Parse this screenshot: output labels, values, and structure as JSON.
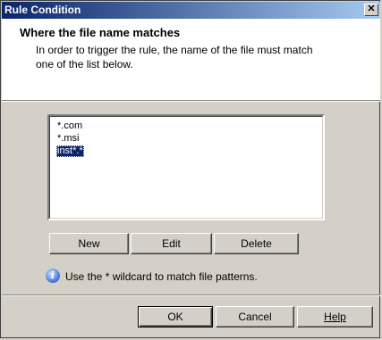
{
  "window": {
    "title": "Rule Condition",
    "close_glyph": "✕"
  },
  "header": {
    "title": "Where the file name matches",
    "description": "In order to trigger the rule, the name of the file must match one of the list below."
  },
  "patterns": {
    "items": [
      "*.com",
      "*.msi",
      "inst*.*"
    ],
    "selected_index": 2
  },
  "list_buttons": {
    "new_label": "New",
    "edit_label": "Edit",
    "delete_label": "Delete"
  },
  "hint": {
    "icon": "info-icon",
    "text": "Use the * wildcard to match file patterns."
  },
  "footer": {
    "ok_label": "OK",
    "cancel_label": "Cancel",
    "help_label": "Help"
  },
  "colors": {
    "titlebar_start": "#0a246a",
    "titlebar_end": "#a6caf0",
    "selection": "#0a246a",
    "face": "#d4d0c8"
  }
}
